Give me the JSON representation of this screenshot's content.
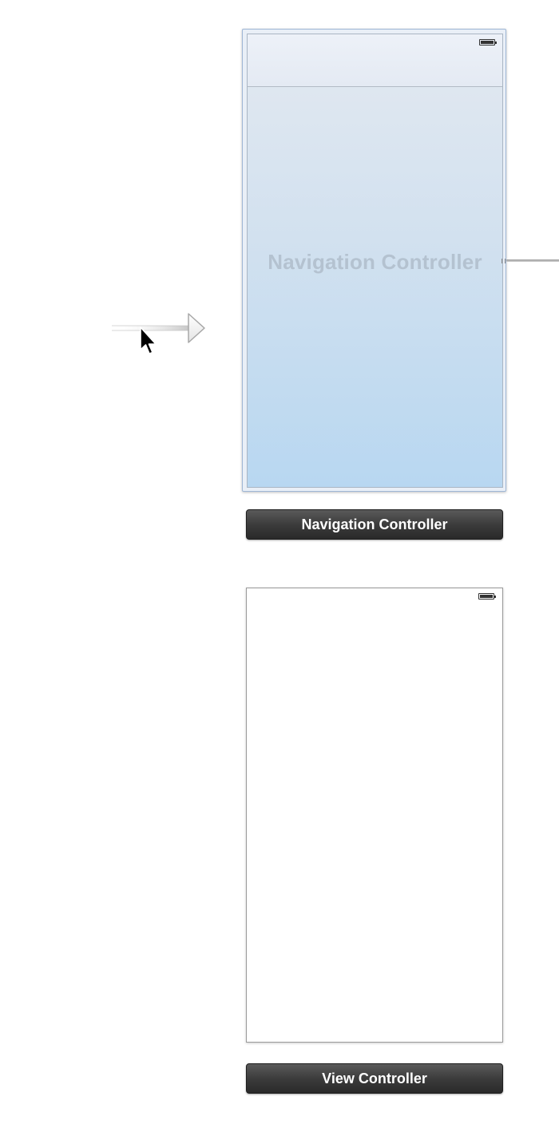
{
  "storyboard": {
    "navigation_controller": {
      "watermark": "Navigation Controller",
      "label": "Navigation Controller",
      "battery_icon": "battery-icon"
    },
    "view_controller": {
      "label": "View Controller",
      "battery_icon": "battery-icon"
    },
    "entry_point": {
      "icon": "initial-scene-arrow-icon"
    },
    "cursor": {
      "icon": "mouse-pointer-icon"
    },
    "colors": {
      "scene_border_selected": "#9fb7d6",
      "scene_gradient_top": "#e3e9f1",
      "scene_gradient_bottom": "#b8d7f1",
      "label_background": "#3c3c3c",
      "label_text": "#ffffff",
      "watermark_text": "#b4c2d0"
    }
  }
}
